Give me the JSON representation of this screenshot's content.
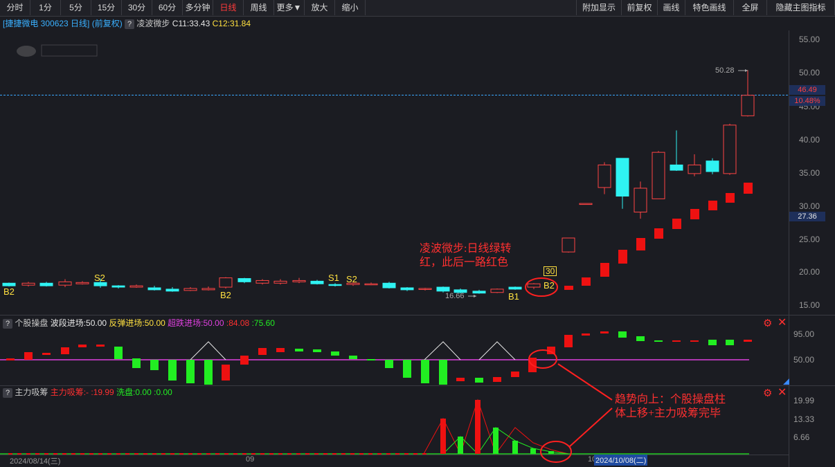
{
  "toolbar": {
    "left": [
      "分时",
      "1分",
      "5分",
      "15分",
      "30分",
      "60分",
      "多分钟",
      "日线",
      "周线",
      "更多▼",
      "放大",
      "缩小"
    ],
    "active": "日线",
    "right": [
      "附加显示",
      "前复权",
      "画线",
      "特色画线",
      "全屏",
      "隐藏主图指标"
    ]
  },
  "header": {
    "stock": "[捷捷微电 300623 日线]",
    "adjust": "(前复权)",
    "q": "?",
    "indicator": "凌波微步",
    "c1": "C11:33.43",
    "c2": "C12:31.84"
  },
  "main_axis": [
    "55.00",
    "50.00",
    "45.00",
    "40.00",
    "35.00",
    "30.00",
    "25.00",
    "20.00",
    "15.00"
  ],
  "price_tags": {
    "current": "46.49",
    "pct": "10.48%",
    "level": "27.36"
  },
  "peak_label": "50.28",
  "low_label": "16.66",
  "b30_label": "30",
  "signals": [
    "B2",
    "S2",
    "B2",
    "S1",
    "S2",
    "B1",
    "B2"
  ],
  "annotation1": {
    "line1": "凌波微步:日线绿转",
    "line2": "红，此后一路红色"
  },
  "annotation2": {
    "line1": "趋势向上：个股操盘柱",
    "line2": "体上移+主力吸筹完毕"
  },
  "panel2": {
    "title": "个股操盘",
    "items": [
      "波段进场:50.00",
      "反弹进场:50.00",
      "超跌进场:50.00",
      ":84.08",
      ":75.60"
    ],
    "axis": [
      "95.00",
      "50.00"
    ]
  },
  "panel3": {
    "title": "主力吸筹",
    "items": [
      "主力吸筹:- :19.99",
      "洗盘:0.00",
      ":0.00"
    ],
    "axis": [
      "19.99",
      "13.33",
      "6.66"
    ]
  },
  "dates": {
    "d1": "2024/08/14(三)",
    "d2": "09",
    "d3": "10",
    "d4": "2024/10/08(二)"
  },
  "colors": {
    "up": "#ff2a2a",
    "down_cyan": "#2ff2f2",
    "green": "#22ee22",
    "magenta": "#e040e0",
    "yellow": "#ffe040"
  }
}
